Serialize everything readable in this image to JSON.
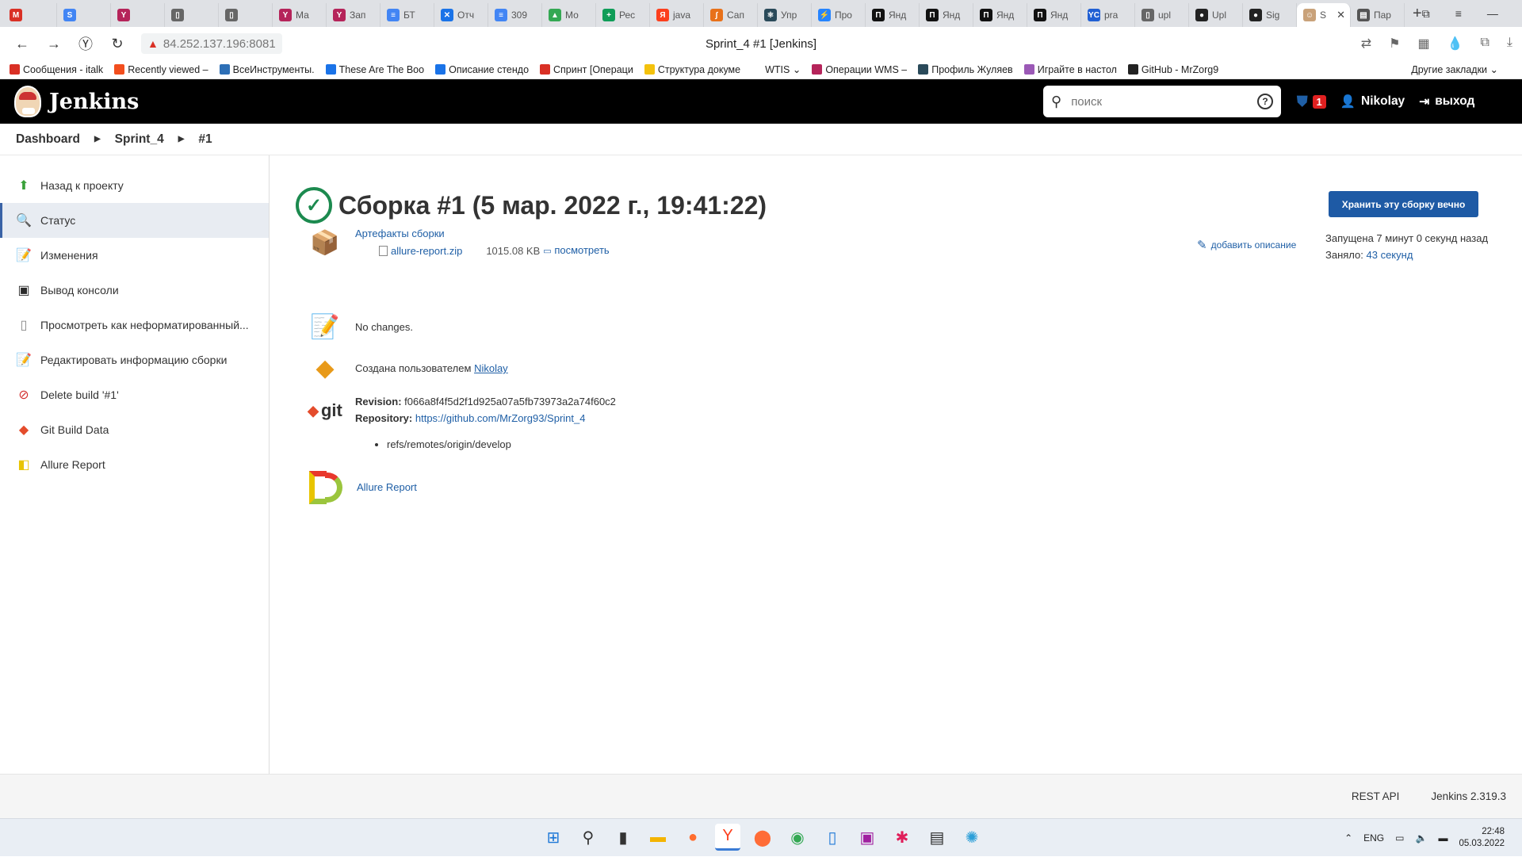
{
  "browser": {
    "tabs": [
      {
        "label": "",
        "color": "#d93025",
        "glyph": "M"
      },
      {
        "label": "",
        "color": "#4285f4",
        "glyph": "S"
      },
      {
        "label": "",
        "color": "#b5245a",
        "glyph": "Y"
      },
      {
        "label": "",
        "color": "#666666",
        "glyph": "▯"
      },
      {
        "label": "",
        "color": "#666666",
        "glyph": "▯"
      },
      {
        "label": "Ма",
        "color": "#b5245a",
        "glyph": "Y"
      },
      {
        "label": "Зап",
        "color": "#b5245a",
        "glyph": "Y"
      },
      {
        "label": "БТ",
        "color": "#4285f4",
        "glyph": "≡"
      },
      {
        "label": "Отч",
        "color": "#1a73e8",
        "glyph": "✕"
      },
      {
        "label": "309",
        "color": "#4285f4",
        "glyph": "≡"
      },
      {
        "label": "Мо",
        "color": "#34a853",
        "glyph": "▲"
      },
      {
        "label": "Рес",
        "color": "#0f9d58",
        "glyph": "+"
      },
      {
        "label": "java",
        "color": "#fc3f1d",
        "glyph": "Я"
      },
      {
        "label": "Сап",
        "color": "#e8711a",
        "glyph": "∫"
      },
      {
        "label": "Упр",
        "color": "#2a4a5a",
        "glyph": "⚛"
      },
      {
        "label": "Про",
        "color": "#2684ff",
        "glyph": "⚡"
      },
      {
        "label": "Янд",
        "color": "#111111",
        "glyph": "П"
      },
      {
        "label": "Янд",
        "color": "#111111",
        "glyph": "П"
      },
      {
        "label": "Янд",
        "color": "#111111",
        "glyph": "П"
      },
      {
        "label": "Янд",
        "color": "#111111",
        "glyph": "П"
      },
      {
        "label": "pra",
        "color": "#2160d4",
        "glyph": "YC"
      },
      {
        "label": "upl",
        "color": "#666666",
        "glyph": "▯"
      },
      {
        "label": "Upl",
        "color": "#222222",
        "glyph": "●"
      },
      {
        "label": "Sig",
        "color": "#222222",
        "glyph": "●"
      },
      {
        "label": "S",
        "color": "#c9a27a",
        "glyph": "☺",
        "active": true
      },
      {
        "label": "Пар",
        "color": "#555555",
        "glyph": "▤"
      }
    ],
    "address_url": "84.252.137.196:8081",
    "page_title": "Sprint_4 #1 [Jenkins]",
    "bookmarks": [
      {
        "label": "Сообщения - italk",
        "color": "#d93025"
      },
      {
        "label": "Recently viewed –",
        "color": "#f24e1e"
      },
      {
        "label": "ВсеИнструменты.",
        "color": "#2d6fb6"
      },
      {
        "label": "These Are The Boo",
        "color": "#1a73e8"
      },
      {
        "label": "Описание стендо",
        "color": "#1a73e8"
      },
      {
        "label": "Спринт [Операци",
        "color": "#d93025"
      },
      {
        "label": "Структура докуме",
        "color": "#f4c20d"
      },
      {
        "label": "WTIS ⌄",
        "color": "#ffffff"
      },
      {
        "label": "Операции WMS –",
        "color": "#b5245a"
      },
      {
        "label": "Профиль Жуляев",
        "color": "#2a4a5a"
      },
      {
        "label": "Играйте в настол",
        "color": "#9b59b6"
      },
      {
        "label": "GitHub - MrZorg9",
        "color": "#222222"
      }
    ],
    "bookmarks_other": "Другие закладки ⌄"
  },
  "header": {
    "title": "Jenkins",
    "search_placeholder": "поиск",
    "alert_count": "1",
    "user": "Nikolay",
    "logout": "выход"
  },
  "breadcrumb": [
    "Dashboard",
    "Sprint_4",
    "#1"
  ],
  "sidebar": {
    "items": [
      {
        "label": "Назад к проекту",
        "icon": "up-arrow-icon",
        "glyph": "⬆",
        "color": "#3aa13a"
      },
      {
        "label": "Статус",
        "icon": "magnifier-icon",
        "glyph": "🔍",
        "color": "#556",
        "active": true
      },
      {
        "label": "Изменения",
        "icon": "notepad-icon",
        "glyph": "📝",
        "color": "#c8a060"
      },
      {
        "label": "Вывод консоли",
        "icon": "terminal-icon",
        "glyph": "▣",
        "color": "#2a2a2a"
      },
      {
        "label": "Просмотреть как неформатированный...",
        "icon": "document-icon",
        "glyph": "▯",
        "color": "#888"
      },
      {
        "label": "Редактировать информацию сборки",
        "icon": "notepad-icon",
        "glyph": "📝",
        "color": "#c8a060"
      },
      {
        "label": "Delete build '#1'",
        "icon": "delete-icon",
        "glyph": "⊘",
        "color": "#d32f2f"
      },
      {
        "label": "Git Build Data",
        "icon": "git-icon",
        "glyph": "◆",
        "color": "#e44c2c"
      },
      {
        "label": "Allure Report",
        "icon": "allure-icon",
        "glyph": "◧",
        "color": "#e8c400"
      }
    ]
  },
  "build": {
    "title": "Сборка #1 (5 мар. 2022 г., 19:41:22)",
    "keep_button": "Хранить эту сборку вечно",
    "add_description": "добавить описание",
    "started": "Запущена 7 минут 0 секунд назад",
    "took_label": "Заняло:",
    "took_value": "43 секунд",
    "artifacts_title": "Артефакты сборки",
    "artifact_file": "allure-report.zip",
    "artifact_size": "1015.08 KB",
    "artifact_view": "посмотреть",
    "changes": "No changes.",
    "created_by_label": "Создана пользователем",
    "created_by_user": "Nikolay",
    "revision_label": "Revision",
    "revision_value": "f066a8f4f5d2f1d925a07a5fb73973a2a74f60c2",
    "repository_label": "Repository",
    "repository_url": "https://github.com/MrZorg93/Sprint_4",
    "branch": "refs/remotes/origin/develop",
    "git_logo": "git",
    "allure_link": "Allure Report"
  },
  "footer": {
    "rest_api": "REST API",
    "version": "Jenkins 2.319.3"
  },
  "taskbar": {
    "lang": "ENG",
    "time": "22:48",
    "date": "05.03.2022"
  }
}
